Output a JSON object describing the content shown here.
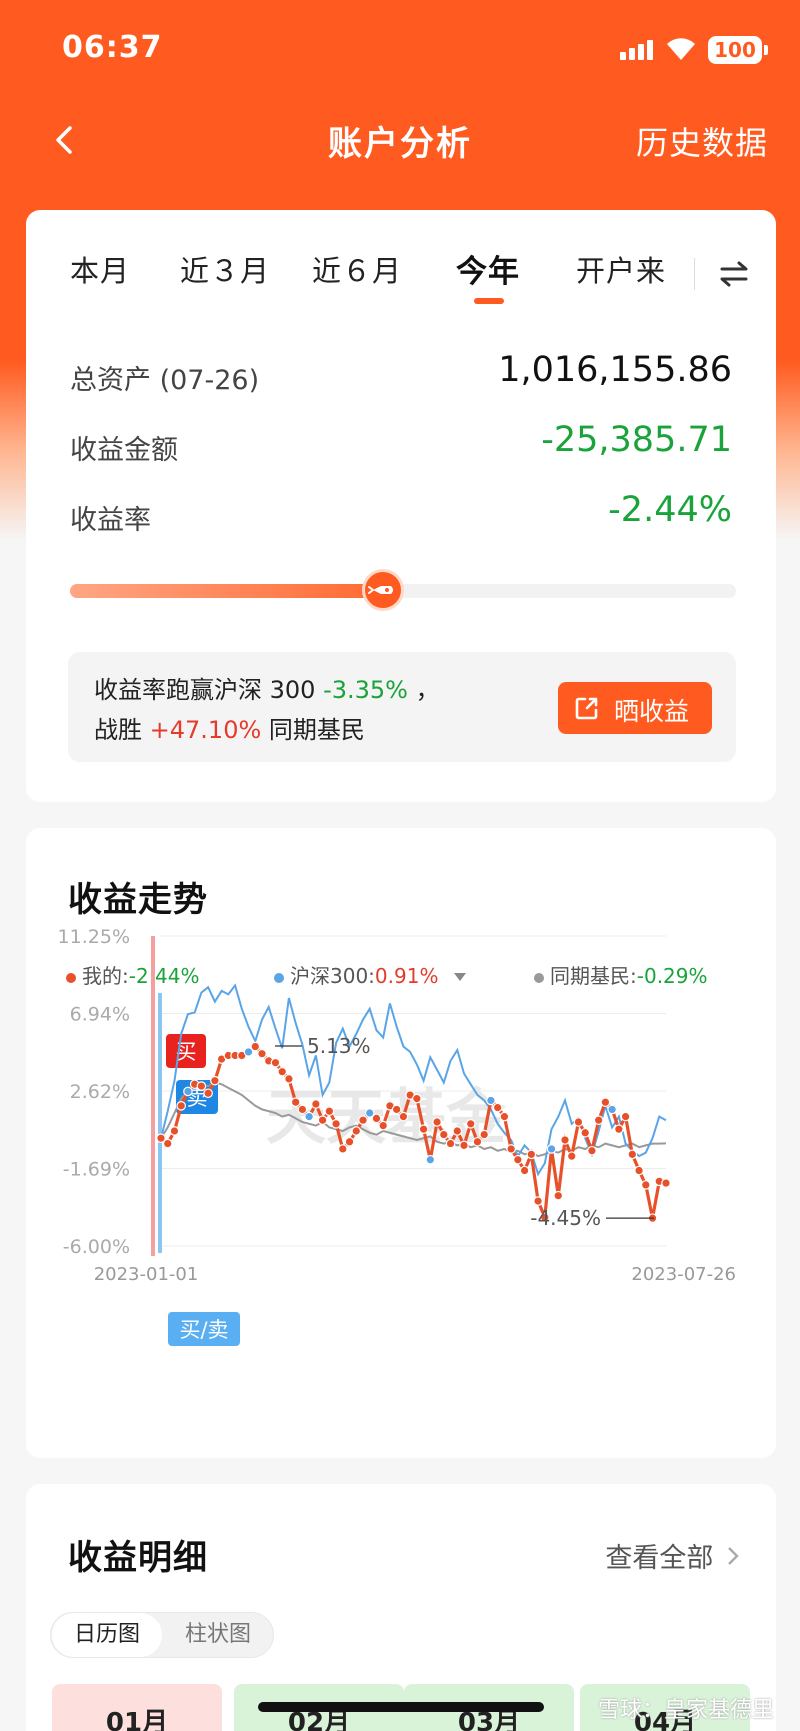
{
  "status": {
    "time": "06:37",
    "battery": "100"
  },
  "nav": {
    "title": "账户分析",
    "right": "历史数据"
  },
  "tabs": [
    "本月",
    "近３月",
    "近６月",
    "今年",
    "开户来"
  ],
  "active_tab": "今年",
  "summary": {
    "total_label": "总资产 (07-26)",
    "total_value": "1,016,155.86",
    "income_label": "收益金额",
    "income_value": "-25,385.71",
    "rate_label": "收益率",
    "rate_value": "-2.44%"
  },
  "slider": {
    "progress": 0.47
  },
  "banner": {
    "l1_a": "收益率跑赢沪深 300 ",
    "l1_b": "-3.35%",
    "l1_c": " ，",
    "l2_a": "战胜 ",
    "l2_b": "+47.10%",
    "l2_c": " 同期基民",
    "button": "晒收益"
  },
  "trend": {
    "title": "收益走势",
    "legend": [
      {
        "name": "我的:",
        "value": "-2.44%",
        "color": "#e8502a",
        "value_color": "#1aa33a"
      },
      {
        "name": "沪深300:",
        "value": "0.91%",
        "color": "#5aa4e8",
        "value_color": "#e43b2c"
      },
      {
        "name": "同期基民:",
        "value": "-0.29%",
        "color": "#999999",
        "value_color": "#1aa33a"
      }
    ],
    "tags": {
      "buy": "买",
      "sell": "卖",
      "buysell": "买/卖"
    },
    "wm": "天天基金"
  },
  "chart_data": {
    "type": "line",
    "x_start": "2023-01-01",
    "x_end": "2023-07-26",
    "y_ticks": [
      "11.25%",
      "6.94%",
      "2.62%",
      "-1.69%",
      "-6.00%"
    ],
    "ylim": [
      -6.0,
      11.25
    ],
    "annotations": {
      "max": "5.13%",
      "min": "-4.45%"
    },
    "series": [
      {
        "name": "我的",
        "color": "#e8502a",
        "values": [
          0.0,
          -0.3,
          0.4,
          1.8,
          2.6,
          3.0,
          2.9,
          2.5,
          3.2,
          4.4,
          4.6,
          4.6,
          4.6,
          4.8,
          5.1,
          4.7,
          4.3,
          4.2,
          3.7,
          3.3,
          2.0,
          1.6,
          1.2,
          1.9,
          1.0,
          1.5,
          0.8,
          -0.6,
          -0.2,
          0.4,
          1.0,
          1.4,
          1.1,
          0.7,
          1.8,
          1.6,
          1.2,
          2.4,
          2.2,
          0.5,
          -1.2,
          0.9,
          0.2,
          -0.3,
          0.4,
          -0.4,
          0.8,
          -0.2,
          0.2,
          2.1,
          1.7,
          1.2,
          -0.6,
          -1.2,
          -1.8,
          -0.9,
          -3.5,
          -4.4,
          -0.6,
          -3.2,
          -0.1,
          -1.0,
          0.9,
          0.3,
          -0.7,
          1.0,
          2.0,
          1.6,
          0.5,
          1.2,
          -0.9,
          -1.8,
          -2.6,
          -4.45,
          -2.4,
          -2.5
        ]
      },
      {
        "name": "沪深300",
        "color": "#5aa4e8",
        "values": [
          0.0,
          1.5,
          3.2,
          5.8,
          6.9,
          7.0,
          8.1,
          8.4,
          7.6,
          8.2,
          8.0,
          8.5,
          7.2,
          6.2,
          5.4,
          6.6,
          7.3,
          6.1,
          5.0,
          7.8,
          6.4,
          5.2,
          3.5,
          4.6,
          2.4,
          3.1,
          5.3,
          6.1,
          5.1,
          5.8,
          6.6,
          7.2,
          6.0,
          5.6,
          7.5,
          6.2,
          5.1,
          4.8,
          4.1,
          3.2,
          4.5,
          3.8,
          3.1,
          4.3,
          4.9,
          3.6,
          3.0,
          2.4,
          2.1,
          1.6,
          0.8,
          0.3,
          -0.1,
          -1.0,
          -0.4,
          -0.8,
          -2.0,
          -1.4,
          0.5,
          1.2,
          2.1,
          0.8,
          1.1,
          0.0,
          -0.9,
          0.4,
          1.8,
          0.6,
          1.2,
          -0.3,
          -0.7,
          -1.0,
          -0.8,
          0.0,
          1.2,
          1.0
        ]
      },
      {
        "name": "同期基民",
        "color": "#999999",
        "values": [
          0.0,
          0.6,
          1.4,
          2.2,
          2.6,
          2.9,
          3.0,
          2.9,
          3.1,
          3.0,
          2.8,
          2.6,
          2.4,
          2.1,
          1.8,
          1.6,
          1.5,
          1.4,
          1.2,
          1.3,
          1.1,
          0.9,
          0.8,
          0.7,
          0.9,
          0.6,
          0.5,
          0.4,
          0.6,
          0.7,
          0.5,
          0.3,
          0.2,
          0.4,
          0.3,
          0.2,
          0.1,
          0.0,
          -0.1,
          0.0,
          0.1,
          -0.2,
          -0.3,
          -0.2,
          -0.4,
          -0.3,
          -0.5,
          -0.4,
          -0.6,
          -0.5,
          -0.7,
          -0.6,
          -0.8,
          -0.7,
          -0.9,
          -0.8,
          -1.0,
          -0.9,
          -0.7,
          -0.8,
          -0.6,
          -0.7,
          -0.5,
          -0.6,
          -0.4,
          -0.5,
          -0.3,
          -0.4,
          -0.5,
          -0.4,
          -0.3,
          -0.5,
          -0.4,
          -0.3,
          -0.3,
          -0.29
        ]
      }
    ]
  },
  "detail": {
    "title": "收益明细",
    "see_all": "查看全部",
    "seg": [
      "日历图",
      "柱状图"
    ],
    "months": [
      "01月",
      "02月",
      "03月",
      "04月"
    ],
    "watermark": "雪球：皇家基德里"
  }
}
